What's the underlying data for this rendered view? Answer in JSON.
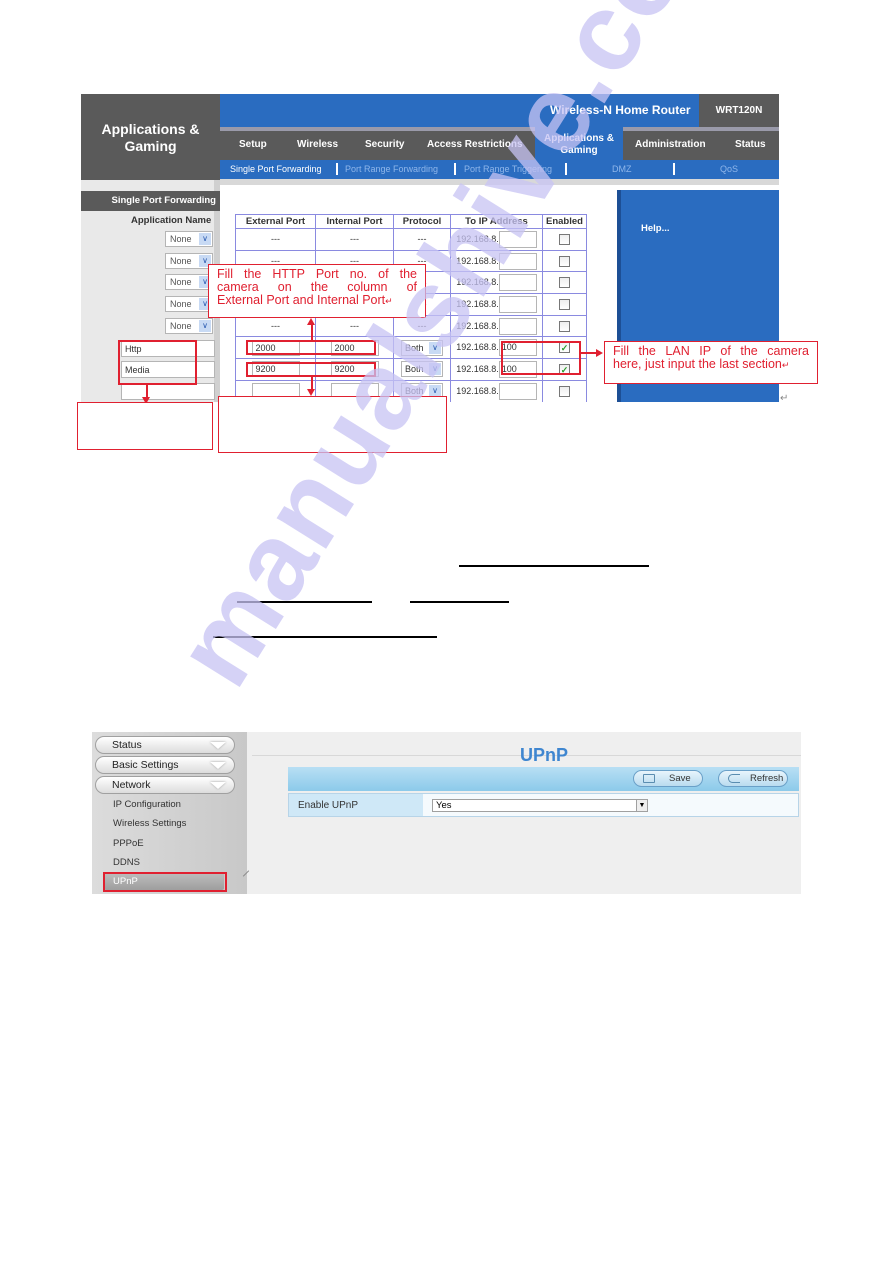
{
  "router": {
    "brand_title_line1": "Applications &",
    "brand_title_line2": "Gaming",
    "product_name": "Wireless-N Home Router",
    "model": "WRT120N",
    "nav_tabs": [
      "Setup",
      "Wireless",
      "Security",
      "Access Restrictions",
      "Applications & Gaming",
      "Administration",
      "Status"
    ],
    "active_tab": "Applications & Gaming",
    "sub_tabs": [
      "Single Port Forwarding",
      "Port Range Forwarding",
      "Port Range Triggering",
      "DMZ",
      "QoS"
    ],
    "active_sub_tab": "Single Port Forwarding",
    "section_title": "Single Port Forwarding",
    "application_name_header": "Application Name",
    "help_text": "Help...",
    "table": {
      "headers": [
        "External Port",
        "Internal Port",
        "Protocol",
        "To IP Address",
        "Enabled"
      ],
      "ip_prefix": "192.168.8.",
      "rows": [
        {
          "app": "None",
          "app_type": "select",
          "external": "---",
          "internal": "---",
          "protocol": "---",
          "ip_last": "",
          "enabled": false
        },
        {
          "app": "None",
          "app_type": "select",
          "external": "---",
          "internal": "---",
          "protocol": "---",
          "ip_last": "",
          "enabled": false
        },
        {
          "app": "None",
          "app_type": "select",
          "external": "---",
          "internal": "---",
          "protocol": "---",
          "ip_last": "",
          "enabled": false
        },
        {
          "app": "None",
          "app_type": "select",
          "external": "---",
          "internal": "---",
          "protocol": "---",
          "ip_last": "",
          "enabled": false
        },
        {
          "app": "None",
          "app_type": "select",
          "external": "---",
          "internal": "---",
          "protocol": "---",
          "ip_last": "",
          "enabled": false
        },
        {
          "app": "Http",
          "app_type": "text",
          "external": "2000",
          "internal": "2000",
          "protocol": "Both",
          "ip_last": "100",
          "enabled": true
        },
        {
          "app": "Media",
          "app_type": "text",
          "external": "9200",
          "internal": "9200",
          "protocol": "Both",
          "ip_last": "100",
          "enabled": true
        },
        {
          "app": "",
          "app_type": "text",
          "external": "",
          "internal": "",
          "protocol": "Both",
          "ip_last": "",
          "enabled": false
        }
      ]
    }
  },
  "annotations": {
    "http_port_callout_line1": "Fill the HTTP Port no. of the",
    "http_port_callout_line2": "camera on the column of",
    "http_port_callout_line3": "External Port and Internal Port",
    "lan_ip_callout_line1": "Fill the LAN IP of the camera",
    "lan_ip_callout_line2": "here, just input the last section",
    "paragraph_mark": "↵",
    "accent_color": "#e02030"
  },
  "watermark": "manualshive.com",
  "upnp": {
    "sidebar_groups": [
      "Status",
      "Basic Settings",
      "Network"
    ],
    "network_items": [
      "IP Configuration",
      "Wireless Settings",
      "PPPoE",
      "DDNS",
      "UPnP"
    ],
    "active_item": "UPnP",
    "page_title": "UPnP",
    "save_label": "Save",
    "refresh_label": "Refresh",
    "enable_label": "Enable UPnP",
    "enable_value": "Yes",
    "title_color": "#3f86d0"
  }
}
